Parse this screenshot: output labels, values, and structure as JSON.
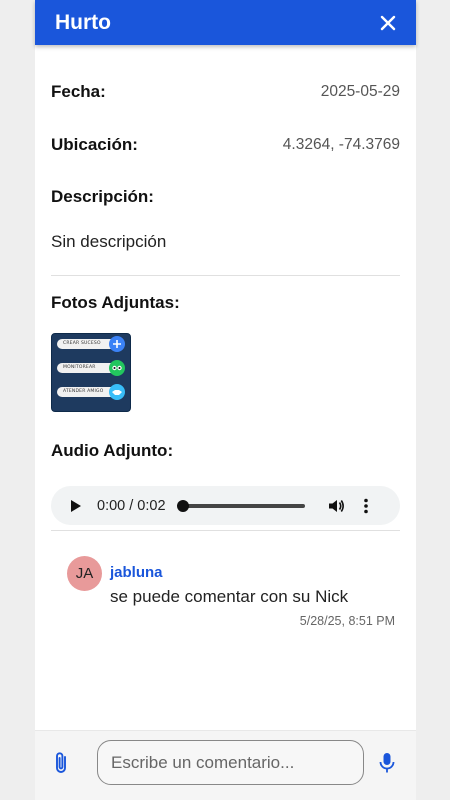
{
  "header": {
    "title": "Hurto"
  },
  "details": {
    "fecha_label": "Fecha:",
    "fecha_value": "2025-05-29",
    "ubicacion_label": "Ubicación:",
    "ubicacion_value": "4.3264, -74.3769",
    "descripcion_label": "Descripción:",
    "descripcion_value": "Sin descripción",
    "fotos_label": "Fotos Adjuntas:",
    "audio_label": "Audio Adjunto:"
  },
  "photo": {
    "items": [
      "CREAR SUCESO",
      "MONITOREAR",
      "ATENDER AMIGO"
    ],
    "colors": {
      "bg": "#1e3a5f",
      "dot1": "#3b82f6",
      "dot2": "#22c55e",
      "dot3": "#38bdf8"
    }
  },
  "audio": {
    "time": "0:00 / 0:02",
    "progress": 0.0
  },
  "comment": {
    "avatar_initials": "JA",
    "user": "jabluna",
    "text": "se puede comentar con su Nick",
    "timestamp": "5/28/25, 8:51 PM"
  },
  "footer": {
    "placeholder": "Escribe un comentario..."
  },
  "colors": {
    "accent": "#1a56db",
    "avatar": "#e89a9a"
  },
  "icons": [
    "close-icon",
    "play-icon",
    "volume-icon",
    "more-vert-icon",
    "paperclip-icon",
    "microphone-icon"
  ]
}
